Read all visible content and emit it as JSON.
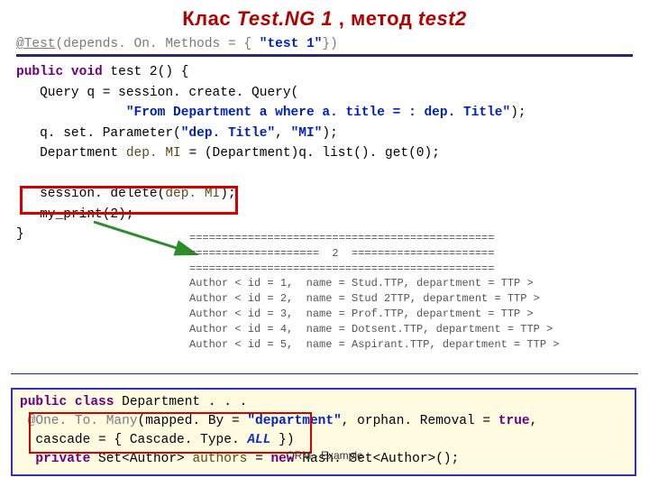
{
  "title": {
    "pre": "Клас ",
    "cls": "Test.NG 1",
    "mid": " ,  метод ",
    "m": "test2"
  },
  "code": {
    "l1_ann": "@Test",
    "l1_rest": "(depends. On. Methods = { ",
    "l1_str": "\"test 1\"",
    "l1_end": "})",
    "l2_pub": "public void",
    "l2_rest": " test 2() {",
    "l3a": "   Query q = session. create. Query(",
    "l4_pre": "              ",
    "l4_str": "\"From Department a where a. title = : dep. Title\"",
    "l4_end": ");",
    "l5_pre": "   q. set. Parameter(",
    "l5_s1": "\"dep. Title\"",
    "l5_mid": ", ",
    "l5_s2": "\"MI\"",
    "l5_end": ");",
    "l6_pre": "   Department ",
    "l6_var": "dep. MI",
    "l6_end": " = (Department)q. list(). get(0);",
    "l7_pre": "   session. delete(",
    "l7_var": "dep. MI",
    "l7_end": ");",
    "l8": "   my_print(2);",
    "l9": "}"
  },
  "console": {
    "sep_top": "===============================================",
    "mid": "====================  2  ======================",
    "sep_bot": "===============================================",
    "rows": [
      "Author < id = 1,  name = Stud.TTP, department = TTP >",
      "Author < id = 2,  name = Stud 2TTP, department = TTP >",
      "Author < id = 3,  name = Prof.TTP, department = TTP >",
      "Author < id = 4,  name = Dotsent.TTP, department = TTP >",
      "Author < id = 5,  name = Aspirant.TTP, department = TTP >"
    ]
  },
  "dept": {
    "l1_kw": "public class",
    "l1_rest": " Department . . .",
    "l2_ann": " @One. To. Many",
    "l2_a": "(mapped. By = ",
    "l2_s": "\"department\"",
    "l2_b": ", orphan. Removal = ",
    "l2_true": "true",
    "l2_c": ",",
    "l3_a": "  cascade = { Cascade. Type. ",
    "l3_all": "ALL",
    "l3_b": " })",
    "l4_kw": "private",
    "l4_a": " Set<Author> ",
    "l4_var": "authors",
    "l4_b": " = ",
    "l4_new": "new",
    "l4_c": " Hash. Set<Author>();"
  },
  "footer": "ORM - Example"
}
